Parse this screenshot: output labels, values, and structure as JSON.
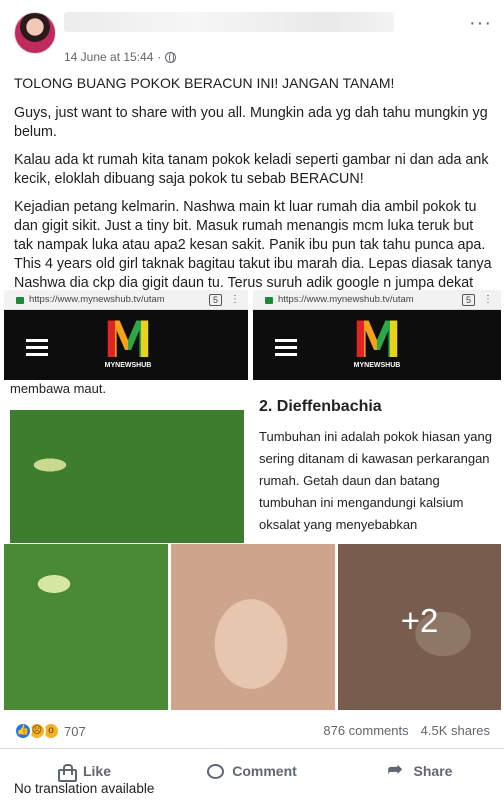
{
  "post": {
    "timestamp": "14 June at 15:44",
    "more_label": "···",
    "paragraphs": [
      "TOLONG BUANG POKOK BERACUN INI! JANGAN TANAM!",
      "Guys, just want to share with you all. Mungkin ada yg dah tahu mungkin yg belum.",
      "Kalau ada kt rumah kita tanam pokok keladi seperti gambar ni dan ada ank kecik, eloklah dibuang saja pokok tu sebab BERACUN!",
      "Kejadian petang kelmarin. Nashwa main kt luar rumah dia ambil pokok tu dan gigit sikit. Just a tiny bit. Masuk rumah menangis mcm luka teruk but tak nampak luka atau apa2 kesan sakit. Panik ibu pun tak tahu punca apa. This 4 years old girl taknak bagitau takut ibu marah dia. Lepas diasak tanya Nashwa dia ckp dia gigit daun tu. Terus suruh adik google n jumpa dekat"
    ]
  },
  "screenshots": {
    "left": {
      "url": "https://www.mynewshub.tv/utam",
      "tab_count": "5",
      "logo_letter": "M",
      "logo_caption": "MYNEWSHUB",
      "cut_text": "membawa maut."
    },
    "right": {
      "url": "https://www.mynewshub.tv/utam",
      "tab_count": "5",
      "logo_letter": "M",
      "logo_caption": "MYNEWSHUB",
      "heading": "2. Dieffenbachia",
      "body": "Tumbuhan ini adalah pokok hiasan yang sering ditanam di kawasan perkarangan rumah. Getah daun dan batang tumbuhan ini mengandungi kalsium oksalat yang menyebabkan"
    }
  },
  "photos": {
    "more_count": "+2"
  },
  "stats": {
    "reaction_count": "707",
    "comments": "876 comments",
    "shares": "4.5K shares",
    "reaction_icons": [
      "like-icon",
      "sad-icon",
      "wow-icon"
    ]
  },
  "actions": {
    "like": "Like",
    "comment": "Comment",
    "share": "Share"
  },
  "footer": {
    "translation_note": "No translation available"
  },
  "colors": {
    "facebook_blue": "#1877f2",
    "meta_gray": "#616770"
  }
}
